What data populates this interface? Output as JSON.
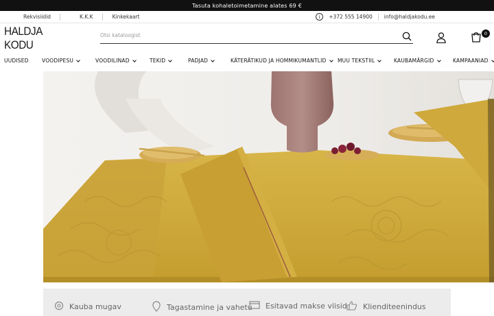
{
  "promo": {
    "text": "Tasuta kohaletoimetamine alates 69 €"
  },
  "util": {
    "links": [
      "Rekvisiidid",
      "K.K.K",
      "Kinkekaart"
    ],
    "phone": "+372 555 14900",
    "email": "info@haldjakodu.ee"
  },
  "header": {
    "logo": "HALDJA KODU",
    "search_placeholder": "Otsi kataloogist",
    "cart_count": "0"
  },
  "nav": {
    "items": [
      {
        "label": "UUDISED",
        "dropdown": false
      },
      {
        "label": "VOODIPESU",
        "dropdown": true
      },
      {
        "label": "VOODILINAD",
        "dropdown": true
      },
      {
        "label": "TEKID",
        "dropdown": true
      },
      {
        "label": "PADJAD",
        "dropdown": true
      },
      {
        "label": "KÄTERÄTIKUD JA HOMMIKUMANTLID",
        "dropdown": true
      },
      {
        "label": "MUU TEKSTIIL",
        "dropdown": true
      },
      {
        "label": "KAUBAMÄRGID",
        "dropdown": true
      },
      {
        "label": "KAMPAANIAD",
        "dropdown": true
      }
    ]
  },
  "features": [
    {
      "label": "Kauba mugav",
      "icon": "location-icon"
    },
    {
      "label": "Tagastamine ja vahetu",
      "icon": "pin-icon"
    },
    {
      "label": "Esitavad makse viisid",
      "icon": "card-icon"
    },
    {
      "label": "Klienditeenindus",
      "icon": "thumbs-up-icon"
    }
  ],
  "colors": {
    "mustard": "#c9a63a",
    "dark": "#111111",
    "plate": "#d6ad55"
  }
}
